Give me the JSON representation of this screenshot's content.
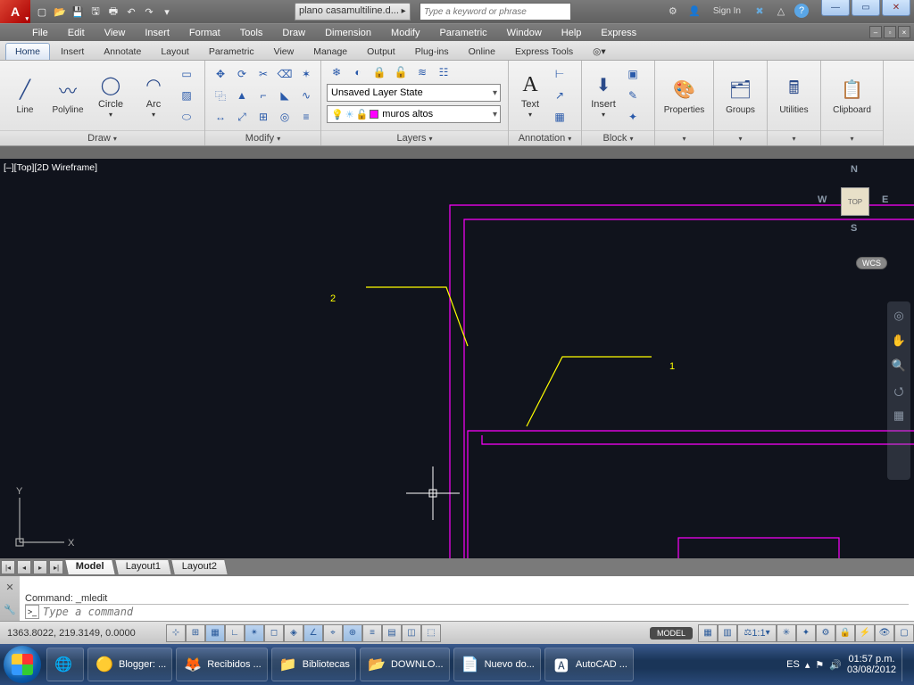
{
  "titlebar": {
    "doc_name": "plano casamultiline.d...",
    "search_placeholder": "Type a keyword or phrase",
    "signin": "Sign In"
  },
  "menubar": [
    "File",
    "Edit",
    "View",
    "Insert",
    "Format",
    "Tools",
    "Draw",
    "Dimension",
    "Modify",
    "Parametric",
    "Window",
    "Help",
    "Express"
  ],
  "ribbon_tabs": [
    "Home",
    "Insert",
    "Annotate",
    "Layout",
    "Parametric",
    "View",
    "Manage",
    "Output",
    "Plug-ins",
    "Online",
    "Express Tools"
  ],
  "active_tab": "Home",
  "panels": {
    "draw": {
      "title": "Draw",
      "items": [
        "Line",
        "Polyline",
        "Circle",
        "Arc"
      ]
    },
    "modify": {
      "title": "Modify"
    },
    "layers": {
      "title": "Layers",
      "state": "Unsaved Layer State",
      "current": "muros altos",
      "swatch": "#ff00ff"
    },
    "annotation": {
      "title": "Annotation",
      "text": "Text"
    },
    "block": {
      "title": "Block",
      "insert": "Insert"
    },
    "properties": {
      "title": "Properties"
    },
    "groups": {
      "title": "Groups"
    },
    "utilities": {
      "title": "Utilities"
    },
    "clipboard": {
      "title": "Clipboard"
    }
  },
  "viewport_label": "[–][Top][2D Wireframe]",
  "viewcube": {
    "face": "TOP",
    "n": "N",
    "s": "S",
    "e": "E",
    "w": "W",
    "wcs": "WCS"
  },
  "annotations": {
    "one": "1",
    "two": "2"
  },
  "layout_tabs": [
    "Model",
    "Layout1",
    "Layout2"
  ],
  "active_layout": "Model",
  "command": {
    "history": "Command: _mledit",
    "placeholder": "Type a command"
  },
  "status": {
    "coords": "1363.8022, 219.3149, 0.0000",
    "model": "MODEL",
    "scale": "1:1"
  },
  "taskbar": {
    "items": [
      {
        "icon": "🌐",
        "label": ""
      },
      {
        "icon": "🟡",
        "label": "Blogger: ..."
      },
      {
        "icon": "🦊",
        "label": "Recibidos ..."
      },
      {
        "icon": "📁",
        "label": "Bibliotecas"
      },
      {
        "icon": "📂",
        "label": "DOWNLO..."
      },
      {
        "icon": "📄",
        "label": "Nuevo do..."
      },
      {
        "icon": "🅰",
        "label": "AutoCAD ..."
      }
    ],
    "lang": "ES",
    "time": "01:57 p.m.",
    "date": "03/08/2012"
  }
}
